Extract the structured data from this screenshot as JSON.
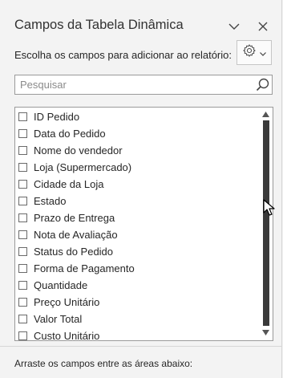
{
  "pane": {
    "title": "Campos da Tabela Dinâmica",
    "subtitle": "Escolha os campos para adicionar ao relatório:",
    "footer": "Arraste os campos entre as áreas abaixo:"
  },
  "search": {
    "placeholder": "Pesquisar"
  },
  "fields": [
    {
      "label": "ID Pedido",
      "checked": false
    },
    {
      "label": "Data do Pedido",
      "checked": false
    },
    {
      "label": "Nome do vendedor",
      "checked": false
    },
    {
      "label": "Loja (Supermercado)",
      "checked": false
    },
    {
      "label": "Cidade da Loja",
      "checked": false
    },
    {
      "label": "Estado",
      "checked": false
    },
    {
      "label": "Prazo de Entrega",
      "checked": false
    },
    {
      "label": "Nota de Avaliação",
      "checked": false
    },
    {
      "label": "Status do Pedido",
      "checked": false
    },
    {
      "label": "Forma de Pagamento",
      "checked": false
    },
    {
      "label": "Quantidade",
      "checked": false
    },
    {
      "label": "Preço Unitário",
      "checked": false
    },
    {
      "label": "Valor Total",
      "checked": false
    },
    {
      "label": "Custo Unitário",
      "checked": false
    }
  ],
  "icons": {
    "collapse": "chevron-down-icon",
    "close": "close-icon",
    "settings": "gear-icon",
    "dropdown": "caret-down-icon",
    "search": "search-icon",
    "scroll_up": "scroll-up-arrow-icon",
    "scroll_down": "scroll-down-arrow-icon",
    "cursor": "mouse-pointer-icon"
  }
}
